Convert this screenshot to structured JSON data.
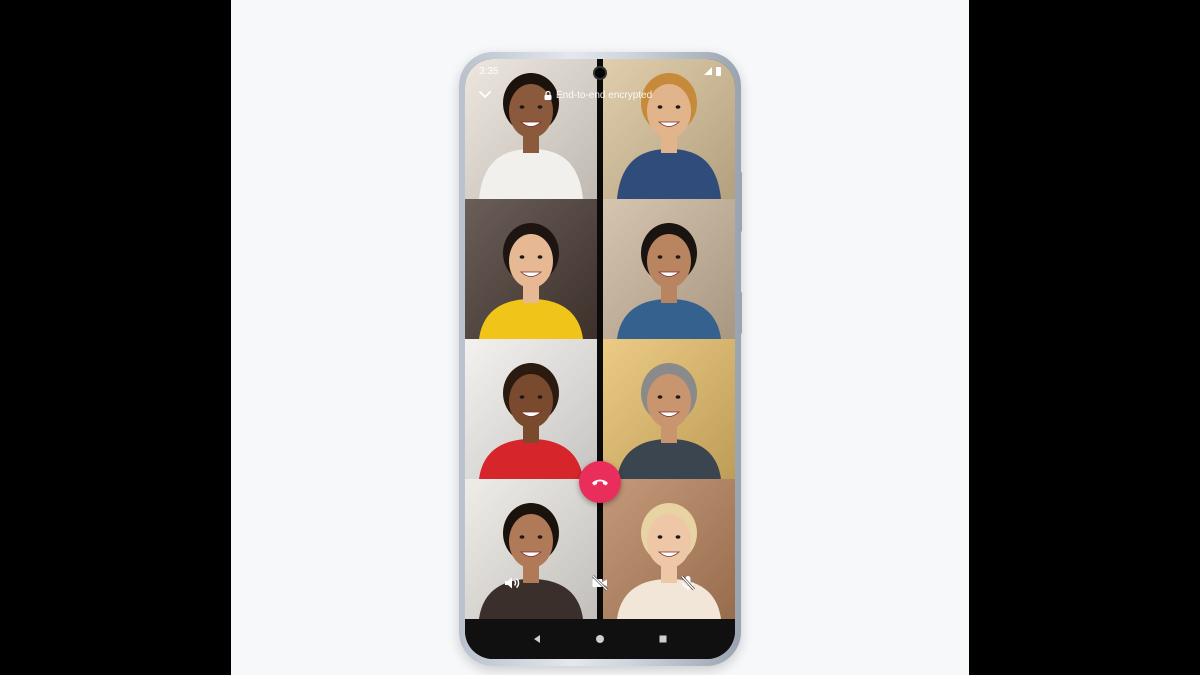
{
  "status_bar": {
    "time": "3:35"
  },
  "call": {
    "encryption_text": "End-to-end encrypted"
  },
  "participants": [
    {
      "name": "participant-1",
      "bg": "#e9e2d8",
      "skin": "#8b5a3c",
      "hair": "#1c120c",
      "shirt": "#f2f0ec"
    },
    {
      "name": "participant-2",
      "bg": "#d9c39a",
      "skin": "#e1b48c",
      "hair": "#c78a3a",
      "shirt": "#2f4c7a"
    },
    {
      "name": "participant-3",
      "bg": "#4a3b34",
      "skin": "#e6b994",
      "hair": "#1e1512",
      "shirt": "#f0c419"
    },
    {
      "name": "participant-4",
      "bg": "#cdb89e",
      "skin": "#b98460",
      "hair": "#1a1410",
      "shirt": "#35618f"
    },
    {
      "name": "participant-5",
      "bg": "#f1efec",
      "skin": "#7a4a2e",
      "hair": "#2b1a10",
      "shirt": "#d7262b"
    },
    {
      "name": "participant-6",
      "bg": "#e7c06a",
      "skin": "#c9956f",
      "hair": "#8a8a8a",
      "shirt": "#3b4550"
    },
    {
      "name": "participant-7",
      "bg": "#ece9e4",
      "skin": "#b07a58",
      "hair": "#1a120d",
      "shirt": "#3a2f2a"
    },
    {
      "name": "participant-8",
      "bg": "#b8845e",
      "skin": "#eec7a6",
      "hair": "#e8d3a3",
      "shirt": "#f2e6d8"
    }
  ],
  "controls": {
    "speaker_icon": "speaker-icon",
    "video_off_icon": "video-off-icon",
    "mute_icon": "mic-off-icon",
    "end_call_icon": "phone-hangup-icon",
    "end_call_color": "#ea2e5b"
  },
  "nav": [
    "back-icon",
    "home-icon",
    "recents-icon"
  ]
}
